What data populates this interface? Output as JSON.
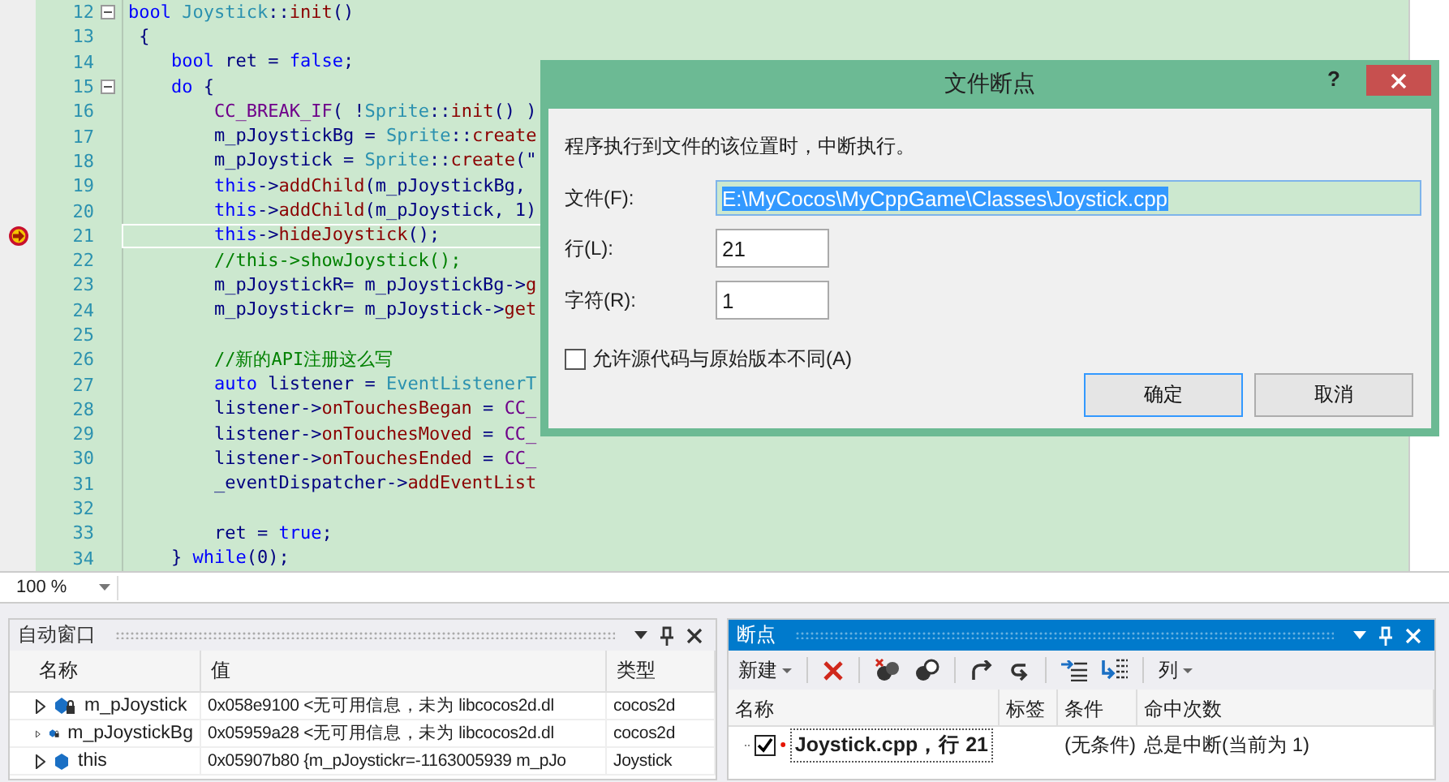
{
  "editor": {
    "lines": [
      {
        "number": "12",
        "fold": true,
        "breakpoint": false,
        "current": false,
        "tokens": [
          {
            "kind": "kw",
            "text": "bool"
          },
          {
            "kind": "type",
            "text": " Joystick"
          },
          {
            "kind": "p",
            "text": "::"
          },
          {
            "kind": "fn",
            "text": "init"
          },
          {
            "kind": "p",
            "text": "()"
          }
        ]
      },
      {
        "number": "13",
        "fold": false,
        "breakpoint": false,
        "current": false,
        "tokens": [
          {
            "kind": "p",
            "text": " {"
          }
        ]
      },
      {
        "number": "14",
        "fold": false,
        "breakpoint": false,
        "current": false,
        "tokens": [
          {
            "kind": "kw",
            "text": "    bool"
          },
          {
            "kind": "p",
            "text": " ret = "
          },
          {
            "kind": "kw",
            "text": "false"
          },
          {
            "kind": "p",
            "text": ";"
          }
        ]
      },
      {
        "number": "15",
        "fold": true,
        "breakpoint": false,
        "current": false,
        "tokens": [
          {
            "kind": "kw",
            "text": "    do"
          },
          {
            "kind": "p",
            "text": " {"
          }
        ]
      },
      {
        "number": "16",
        "fold": false,
        "breakpoint": false,
        "current": false,
        "tokens": [
          {
            "kind": "macro",
            "text": "        CC_BREAK_IF"
          },
          {
            "kind": "p",
            "text": "( !"
          },
          {
            "kind": "type",
            "text": "Sprite"
          },
          {
            "kind": "p",
            "text": "::"
          },
          {
            "kind": "fn",
            "text": "init"
          },
          {
            "kind": "p",
            "text": "() )"
          }
        ]
      },
      {
        "number": "17",
        "fold": false,
        "breakpoint": false,
        "current": false,
        "tokens": [
          {
            "kind": "p",
            "text": "        m_pJoystickBg = "
          },
          {
            "kind": "type",
            "text": "Sprite"
          },
          {
            "kind": "p",
            "text": "::"
          },
          {
            "kind": "fn",
            "text": "create"
          }
        ]
      },
      {
        "number": "18",
        "fold": false,
        "breakpoint": false,
        "current": false,
        "tokens": [
          {
            "kind": "p",
            "text": "        m_pJoystick = "
          },
          {
            "kind": "type",
            "text": "Sprite"
          },
          {
            "kind": "p",
            "text": "::"
          },
          {
            "kind": "fn",
            "text": "create"
          },
          {
            "kind": "p",
            "text": "(\""
          }
        ]
      },
      {
        "number": "19",
        "fold": false,
        "breakpoint": false,
        "current": false,
        "tokens": [
          {
            "kind": "kw",
            "text": "        this"
          },
          {
            "kind": "p",
            "text": "->"
          },
          {
            "kind": "fn",
            "text": "addChild"
          },
          {
            "kind": "p",
            "text": "(m_pJoystickBg,"
          }
        ]
      },
      {
        "number": "20",
        "fold": false,
        "breakpoint": false,
        "current": false,
        "tokens": [
          {
            "kind": "kw",
            "text": "        this"
          },
          {
            "kind": "p",
            "text": "->"
          },
          {
            "kind": "fn",
            "text": "addChild"
          },
          {
            "kind": "p",
            "text": "(m_pJoystick, 1)"
          }
        ]
      },
      {
        "number": "21",
        "fold": false,
        "breakpoint": true,
        "current": true,
        "tokens": [
          {
            "kind": "kw",
            "text": "        this"
          },
          {
            "kind": "p",
            "text": "->"
          },
          {
            "kind": "fn",
            "text": "hideJoystick"
          },
          {
            "kind": "p",
            "text": "();"
          }
        ]
      },
      {
        "number": "22",
        "fold": false,
        "breakpoint": false,
        "current": false,
        "tokens": [
          {
            "kind": "cm",
            "text": "        //this->showJoystick();"
          }
        ]
      },
      {
        "number": "23",
        "fold": false,
        "breakpoint": false,
        "current": false,
        "tokens": [
          {
            "kind": "p",
            "text": "        m_pJoystickR= m_pJoystickBg->"
          },
          {
            "kind": "fn",
            "text": "g"
          }
        ]
      },
      {
        "number": "24",
        "fold": false,
        "breakpoint": false,
        "current": false,
        "tokens": [
          {
            "kind": "p",
            "text": "        m_pJoystickr= m_pJoystick->"
          },
          {
            "kind": "fn",
            "text": "get"
          }
        ]
      },
      {
        "number": "25",
        "fold": false,
        "breakpoint": false,
        "current": false
      },
      {
        "number": "26",
        "fold": false,
        "breakpoint": false,
        "current": false,
        "tokens": [
          {
            "kind": "cm",
            "text": "        //新的API注册这么写"
          }
        ]
      },
      {
        "number": "27",
        "fold": false,
        "breakpoint": false,
        "current": false,
        "tokens": [
          {
            "kind": "kw",
            "text": "        auto"
          },
          {
            "kind": "p",
            "text": " listener = "
          },
          {
            "kind": "type",
            "text": "EventListenerT"
          }
        ]
      },
      {
        "number": "28",
        "fold": false,
        "breakpoint": false,
        "current": false,
        "tokens": [
          {
            "kind": "p",
            "text": "        listener->"
          },
          {
            "kind": "fn",
            "text": "onTouchesBegan"
          },
          {
            "kind": "p",
            "text": " = "
          },
          {
            "kind": "macro",
            "text": "CC_"
          }
        ]
      },
      {
        "number": "29",
        "fold": false,
        "breakpoint": false,
        "current": false,
        "tokens": [
          {
            "kind": "p",
            "text": "        listener->"
          },
          {
            "kind": "fn",
            "text": "onTouchesMoved"
          },
          {
            "kind": "p",
            "text": " = "
          },
          {
            "kind": "macro",
            "text": "CC_"
          }
        ]
      },
      {
        "number": "30",
        "fold": false,
        "breakpoint": false,
        "current": false,
        "tokens": [
          {
            "kind": "p",
            "text": "        listener->"
          },
          {
            "kind": "fn",
            "text": "onTouchesEnded"
          },
          {
            "kind": "p",
            "text": " = "
          },
          {
            "kind": "macro",
            "text": "CC_"
          }
        ]
      },
      {
        "number": "31",
        "fold": false,
        "breakpoint": false,
        "current": false,
        "tokens": [
          {
            "kind": "p",
            "text": "        _eventDispatcher->"
          },
          {
            "kind": "fn",
            "text": "addEventList"
          }
        ]
      },
      {
        "number": "32",
        "fold": false,
        "breakpoint": false,
        "current": false
      },
      {
        "number": "33",
        "fold": false,
        "breakpoint": false,
        "current": false,
        "tokens": [
          {
            "kind": "p",
            "text": "        ret = "
          },
          {
            "kind": "kw",
            "text": "true"
          },
          {
            "kind": "p",
            "text": ";"
          }
        ]
      },
      {
        "number": "34",
        "fold": false,
        "breakpoint": false,
        "current": false,
        "tokens": [
          {
            "kind": "p",
            "text": "    } "
          },
          {
            "kind": "kw",
            "text": "while"
          },
          {
            "kind": "p",
            "text": "(0);"
          }
        ]
      }
    ],
    "zoom": "100 %"
  },
  "dialog": {
    "title": "文件断点",
    "help": "?",
    "message": "程序执行到文件的该位置时，中断执行。",
    "fields": [
      {
        "label": "文件(F):",
        "value": "E:\\MyCocos\\MyCppGame\\Classes\\Joystick.cpp",
        "focused": true
      },
      {
        "label": "行(L):",
        "value": "21",
        "focused": false
      },
      {
        "label": "字符(R):",
        "value": "1",
        "focused": false
      }
    ],
    "checkbox": {
      "label": "允许源代码与原始版本不同(A)",
      "checked": false
    },
    "buttons": [
      {
        "label": "确定",
        "default": true
      },
      {
        "label": "取消",
        "default": false
      }
    ]
  },
  "autos_panel": {
    "title": "自动窗口",
    "active": false,
    "columns": [
      "名称",
      "值",
      "类型"
    ],
    "rows": [
      {
        "kind": "private",
        "name": "m_pJoystick",
        "value": "0x058e9100 <无可用信息，未为 libcocos2d.dl",
        "type": "cocos2d"
      },
      {
        "kind": "private",
        "name": "m_pJoystickBg",
        "value": "0x05959a28 <无可用信息，未为 libcocos2d.dl",
        "type": "cocos2d"
      },
      {
        "kind": "local",
        "name": "this",
        "value": "0x05907b80 {m_pJoystickr=-1163005939 m_pJo",
        "type": "Joystick"
      }
    ]
  },
  "breakpoints_panel": {
    "title": "断点",
    "active": true,
    "new_label": "新建",
    "columns_label": "列",
    "columns": [
      "名称",
      "标签",
      "条件",
      "命中次数"
    ],
    "rows": [
      {
        "checked": true,
        "name": "Joystick.cpp，行 21",
        "condition": "(无条件)",
        "hit_count": "总是中断(当前为 1)"
      }
    ]
  }
}
